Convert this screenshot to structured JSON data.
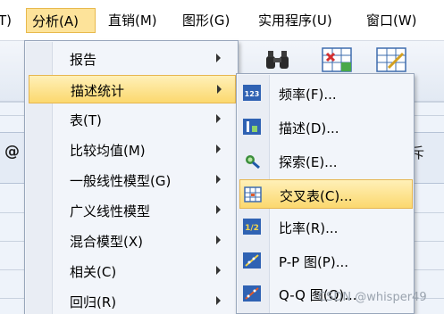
{
  "menubar": {
    "items": [
      {
        "label": "T)"
      },
      {
        "label": "分析(A)"
      },
      {
        "label": "直销(M)"
      },
      {
        "label": "图形(G)"
      },
      {
        "label": "实用程序(U)"
      },
      {
        "label": "窗口(W)"
      }
    ],
    "active_index": 1
  },
  "background": {
    "grid_left_text": "@",
    "grid_right_text": "斥"
  },
  "analyze_menu": {
    "items": [
      {
        "label": "报告",
        "has_submenu": true
      },
      {
        "label": "描述统计",
        "has_submenu": true,
        "selected": true
      },
      {
        "label": "表(T)",
        "has_submenu": true
      },
      {
        "label": "比较均值(M)",
        "has_submenu": true
      },
      {
        "label": "一般线性模型(G)",
        "has_submenu": true
      },
      {
        "label": "广义线性模型",
        "has_submenu": true
      },
      {
        "label": "混合模型(X)",
        "has_submenu": true
      },
      {
        "label": "相关(C)",
        "has_submenu": true
      },
      {
        "label": "回归(R)",
        "has_submenu": true
      }
    ]
  },
  "descriptive_submenu": {
    "items": [
      {
        "label": "频率(F)...",
        "icon": "frequencies-icon"
      },
      {
        "label": "描述(D)...",
        "icon": "descriptives-icon"
      },
      {
        "label": "探索(E)...",
        "icon": "explore-icon"
      },
      {
        "label": "交叉表(C)...",
        "icon": "crosstabs-icon",
        "selected": true
      },
      {
        "label": "比率(R)...",
        "icon": "ratio-icon"
      },
      {
        "label": "P-P 图(P)...",
        "icon": "pp-plot-icon"
      },
      {
        "label": "Q-Q 图(Q)...",
        "icon": "qq-plot-icon"
      }
    ]
  },
  "watermark": "CSDN @whisper49",
  "colors": {
    "highlight": "#fbd86e",
    "menu_bg": "#f2f5fa",
    "border": "#98a6bb"
  }
}
